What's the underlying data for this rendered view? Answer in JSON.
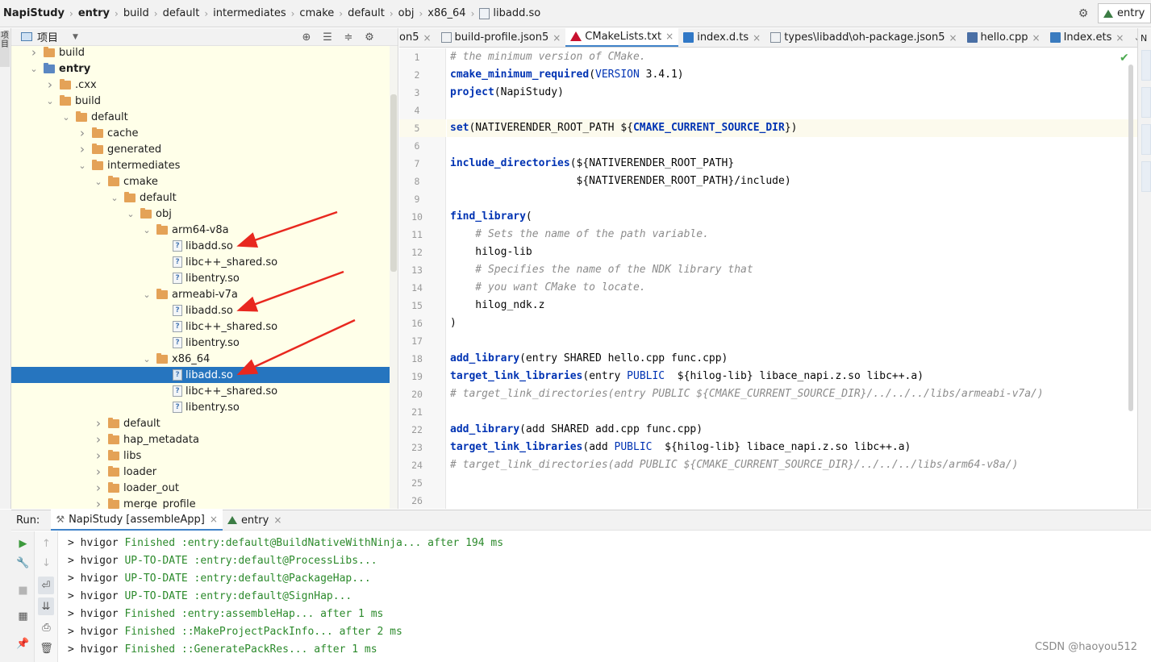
{
  "breadcrumb": [
    {
      "label": "NapiStudy",
      "bold": true
    },
    {
      "label": "entry",
      "bold": true
    },
    {
      "label": "build",
      "bold": false
    },
    {
      "label": "default",
      "bold": false
    },
    {
      "label": "intermediates",
      "bold": false
    },
    {
      "label": "cmake",
      "bold": false
    },
    {
      "label": "default",
      "bold": false
    },
    {
      "label": "obj",
      "bold": false
    },
    {
      "label": "x86_64",
      "bold": false
    },
    {
      "label": "libadd.so",
      "bold": false,
      "icon": "so-file-icon"
    }
  ],
  "nav_right": {
    "settings_icon": "gear-icon",
    "run_config": "entry",
    "run_config_icon": "triangle-module-icon"
  },
  "left_strip": {
    "tab_label": "项目"
  },
  "project_panel": {
    "title": "项目",
    "tools": [
      "locate-icon",
      "expand-all-icon",
      "collapse-all-icon",
      "gear-icon"
    ],
    "tree": [
      {
        "label": "build",
        "arrow": "right",
        "kind": "folder",
        "depth": 1
      },
      {
        "label": "entry",
        "arrow": "down",
        "kind": "module",
        "depth": 1,
        "bold": true
      },
      {
        "label": ".cxx",
        "arrow": "right",
        "kind": "folder",
        "depth": 2
      },
      {
        "label": "build",
        "arrow": "down",
        "kind": "folder",
        "depth": 2
      },
      {
        "label": "default",
        "arrow": "down",
        "kind": "folder",
        "depth": 3
      },
      {
        "label": "cache",
        "arrow": "right",
        "kind": "folder",
        "depth": 4
      },
      {
        "label": "generated",
        "arrow": "right",
        "kind": "folder",
        "depth": 4
      },
      {
        "label": "intermediates",
        "arrow": "down",
        "kind": "folder",
        "depth": 4
      },
      {
        "label": "cmake",
        "arrow": "down",
        "kind": "folder",
        "depth": 5
      },
      {
        "label": "default",
        "arrow": "down",
        "kind": "folder",
        "depth": 6
      },
      {
        "label": "obj",
        "arrow": "down",
        "kind": "folder",
        "depth": 7
      },
      {
        "label": "arm64-v8a",
        "arrow": "down",
        "kind": "folder",
        "depth": 8
      },
      {
        "label": "libadd.so",
        "arrow": "none",
        "kind": "so",
        "depth": 9
      },
      {
        "label": "libc++_shared.so",
        "arrow": "none",
        "kind": "so",
        "depth": 9
      },
      {
        "label": "libentry.so",
        "arrow": "none",
        "kind": "so",
        "depth": 9
      },
      {
        "label": "armeabi-v7a",
        "arrow": "down",
        "kind": "folder",
        "depth": 8
      },
      {
        "label": "libadd.so",
        "arrow": "none",
        "kind": "so",
        "depth": 9
      },
      {
        "label": "libc++_shared.so",
        "arrow": "none",
        "kind": "so",
        "depth": 9
      },
      {
        "label": "libentry.so",
        "arrow": "none",
        "kind": "so",
        "depth": 9
      },
      {
        "label": "x86_64",
        "arrow": "down",
        "kind": "folder",
        "depth": 8
      },
      {
        "label": "libadd.so",
        "arrow": "none",
        "kind": "so",
        "depth": 9,
        "selected": true
      },
      {
        "label": "libc++_shared.so",
        "arrow": "none",
        "kind": "so",
        "depth": 9
      },
      {
        "label": "libentry.so",
        "arrow": "none",
        "kind": "so",
        "depth": 9
      },
      {
        "label": "default",
        "arrow": "right",
        "kind": "folder",
        "depth": 5
      },
      {
        "label": "hap_metadata",
        "arrow": "right",
        "kind": "folder",
        "depth": 5
      },
      {
        "label": "libs",
        "arrow": "right",
        "kind": "folder",
        "depth": 5
      },
      {
        "label": "loader",
        "arrow": "right",
        "kind": "folder",
        "depth": 5
      },
      {
        "label": "loader_out",
        "arrow": "right",
        "kind": "folder",
        "depth": 5
      },
      {
        "label": "merge_profile",
        "arrow": "right",
        "kind": "folder",
        "depth": 5
      }
    ]
  },
  "editor_tabs": [
    {
      "label": "on5",
      "icon": "none",
      "close": true
    },
    {
      "label": "build-profile.json5",
      "icon": "json-file-icon",
      "close": true
    },
    {
      "label": "CMakeLists.txt",
      "icon": "cmake-file-icon",
      "close": true,
      "active": true
    },
    {
      "label": "index.d.ts",
      "icon": "ts-file-icon",
      "close": true
    },
    {
      "label": "types\\libadd\\oh-package.json5",
      "icon": "json-file-icon",
      "close": true
    },
    {
      "label": "hello.cpp",
      "icon": "cpp-file-icon",
      "close": true
    },
    {
      "label": "Index.ets",
      "icon": "ets-file-icon",
      "close": true
    }
  ],
  "right_strip": {
    "label": "N"
  },
  "editor": {
    "current_line": 5,
    "lines": [
      [
        {
          "t": "# the minimum version of CMake.",
          "c": "c-comment"
        }
      ],
      [
        {
          "t": "cmake_minimum_required",
          "c": "c-cmd"
        },
        {
          "t": "(",
          "c": ""
        },
        {
          "t": "VERSION",
          "c": "c-kw"
        },
        {
          "t": " 3.4.1)",
          "c": ""
        }
      ],
      [
        {
          "t": "project",
          "c": "c-cmd"
        },
        {
          "t": "(NapiStudy)",
          "c": ""
        }
      ],
      [],
      [
        {
          "t": "set",
          "c": "c-cmd"
        },
        {
          "t": "(NATIVERENDER_ROOT_PATH ${",
          "c": ""
        },
        {
          "t": "CMAKE_CURRENT_SOURCE_DIR",
          "c": "c-var"
        },
        {
          "t": "})",
          "c": ""
        }
      ],
      [],
      [
        {
          "t": "include_directories",
          "c": "c-cmd"
        },
        {
          "t": "(${NATIVERENDER_ROOT_PATH}",
          "c": ""
        }
      ],
      [
        {
          "t": "                    ${NATIVERENDER_ROOT_PATH}/include)",
          "c": ""
        }
      ],
      [],
      [
        {
          "t": "find_library",
          "c": "c-cmd"
        },
        {
          "t": "(",
          "c": ""
        }
      ],
      [
        {
          "t": "    # Sets the name of the path variable.",
          "c": "c-comment"
        }
      ],
      [
        {
          "t": "    hilog-lib",
          "c": ""
        }
      ],
      [
        {
          "t": "    # Specifies the name of the NDK library that",
          "c": "c-comment"
        }
      ],
      [
        {
          "t": "    # you want CMake to locate.",
          "c": "c-comment"
        }
      ],
      [
        {
          "t": "    hilog_ndk.z",
          "c": ""
        }
      ],
      [
        {
          "t": ")",
          "c": ""
        }
      ],
      [],
      [
        {
          "t": "add_library",
          "c": "c-cmd"
        },
        {
          "t": "(entry SHARED hello.cpp func.cpp)",
          "c": ""
        }
      ],
      [
        {
          "t": "target_link_libraries",
          "c": "c-cmd"
        },
        {
          "t": "(entry ",
          "c": ""
        },
        {
          "t": "PUBLIC",
          "c": "c-kw"
        },
        {
          "t": "  ${hilog-lib} libace_napi.z.so libc++.a)",
          "c": ""
        }
      ],
      [
        {
          "t": "# target_link_directories(entry PUBLIC ${CMAKE_CURRENT_SOURCE_DIR}/../../../libs/armeabi-v7a/)",
          "c": "c-comment"
        }
      ],
      [],
      [
        {
          "t": "add_library",
          "c": "c-cmd"
        },
        {
          "t": "(add SHARED add.cpp func.cpp)",
          "c": ""
        }
      ],
      [
        {
          "t": "target_link_libraries",
          "c": "c-cmd"
        },
        {
          "t": "(add ",
          "c": ""
        },
        {
          "t": "PUBLIC",
          "c": "c-kw"
        },
        {
          "t": "  ${hilog-lib} libace_napi.z.so libc++.a)",
          "c": ""
        }
      ],
      [
        {
          "t": "# target_link_directories(add PUBLIC ${CMAKE_CURRENT_SOURCE_DIR}/../../../libs/arm64-v8a/)",
          "c": "c-comment"
        }
      ],
      [],
      []
    ]
  },
  "run_panel": {
    "label": "Run:",
    "tabs": [
      {
        "label": "NapiStudy [assembleApp]",
        "icon": "hammer-icon",
        "active": true
      },
      {
        "label": "entry",
        "icon": "triangle-module-icon",
        "active": false
      }
    ],
    "console": [
      {
        "prefix": "> hvigor ",
        "status": "Finished",
        "rest": " :entry:default@BuildNativeWithNinja... after 194 ms"
      },
      {
        "prefix": "> hvigor ",
        "status": "UP-TO-DATE",
        "rest": " :entry:default@ProcessLibs..."
      },
      {
        "prefix": "> hvigor ",
        "status": "UP-TO-DATE",
        "rest": " :entry:default@PackageHap..."
      },
      {
        "prefix": "> hvigor ",
        "status": "UP-TO-DATE",
        "rest": " :entry:default@SignHap..."
      },
      {
        "prefix": "> hvigor ",
        "status": "Finished",
        "rest": " :entry:assembleHap... after 1 ms"
      },
      {
        "prefix": "> hvigor ",
        "status": "Finished",
        "rest": " ::MakeProjectPackInfo... after 2 ms"
      },
      {
        "prefix": "> hvigor ",
        "status": "Finished",
        "rest": " ::GeneratePackRes... after 1 ms"
      }
    ]
  },
  "watermark": "CSDN @haoyou512",
  "colors": {
    "selection": "#2675bf",
    "project_bg": "#ffffe9",
    "annotation_arrow": "#e8281f",
    "console_status": "#2c8a2c"
  }
}
